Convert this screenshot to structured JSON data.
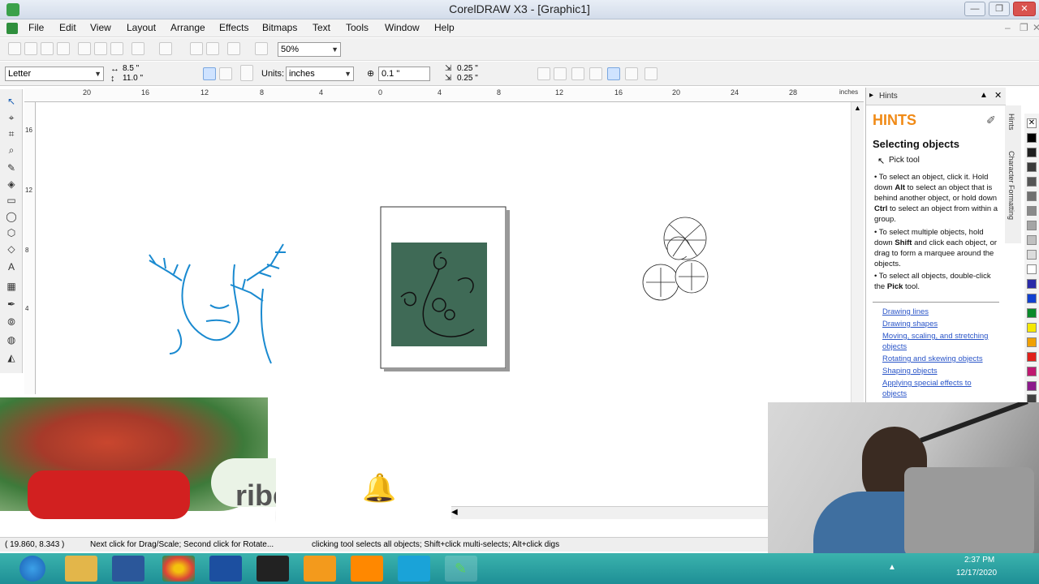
{
  "window": {
    "title": "CorelDRAW X3 - [Graphic1]",
    "minimize_glyph": "—",
    "restore_glyph": "❐",
    "close_glyph": "✕"
  },
  "menu": [
    "File",
    "Edit",
    "View",
    "Layout",
    "Arrange",
    "Effects",
    "Bitmaps",
    "Text",
    "Tools",
    "Window",
    "Help"
  ],
  "toolbar": {
    "zoom_value": "50%"
  },
  "property_bar": {
    "page_size": "Letter",
    "width": "8.5 \"",
    "height": "11.0 \"",
    "units_label": "Units:",
    "units_value": "inches",
    "nudge": "0.1 \"",
    "dup_x": "0.25 \"",
    "dup_y": "0.25 \""
  },
  "rulers": {
    "h_ticks": [
      "20",
      "16",
      "12",
      "8",
      "4",
      "0",
      "4",
      "8",
      "12",
      "16",
      "20",
      "24",
      "28"
    ],
    "h_unit": "inches",
    "v_ticks": [
      "16",
      "12",
      "8",
      "4"
    ]
  },
  "dock": {
    "panel_name": "Hints",
    "hints_title": "HINTS",
    "topic": "Selecting objects",
    "tool_name": "Pick tool",
    "bullets": [
      {
        "pre": "To select an object, click it. Hold down ",
        "b1": "Alt",
        "mid": " to select an object that is behind another object, or hold down ",
        "b2": "Ctrl",
        "post": " to select an object from within a group."
      },
      {
        "pre": "To select multiple objects, hold down ",
        "b1": "Shift",
        "mid": " and click each object, or drag to form a marquee around the objects.",
        "b2": "",
        "post": ""
      },
      {
        "pre": "To select all objects, double-click the ",
        "b1": "Pick",
        "mid": " tool.",
        "b2": "",
        "post": ""
      }
    ],
    "links": [
      "Drawing lines",
      "Drawing shapes",
      "Moving, scaling, and stretching objects",
      "Rotating and skewing objects",
      "Shaping objects",
      "Applying special effects to objects"
    ],
    "side_tabs": [
      "Hints",
      "Character Formatting"
    ]
  },
  "palette_colors": [
    "#ffffff",
    "#000000",
    "#1f1f1f",
    "#3a3a3a",
    "#555555",
    "#707070",
    "#8a8a8a",
    "#a5a5a5",
    "#c0c0c0",
    "#dcdcdc",
    "#ffffff",
    "#2a2aa8",
    "#1040d0",
    "#0a8a2a",
    "#f5e800",
    "#f0a000",
    "#e0201a",
    "#c01870",
    "#8c1a8c",
    "#404040"
  ],
  "status": {
    "coords": "( 19.860, 8.343 )",
    "message_left": "Next click for Drag/Scale; Second click for Rotate...",
    "message_right": "clicking tool selects all objects; Shift+click multi-selects; Alt+click digs"
  },
  "overlay": {
    "subscribe_text": "ribe"
  },
  "taskbar": {
    "time": "2:37 PM",
    "date": "12/17/2020"
  }
}
